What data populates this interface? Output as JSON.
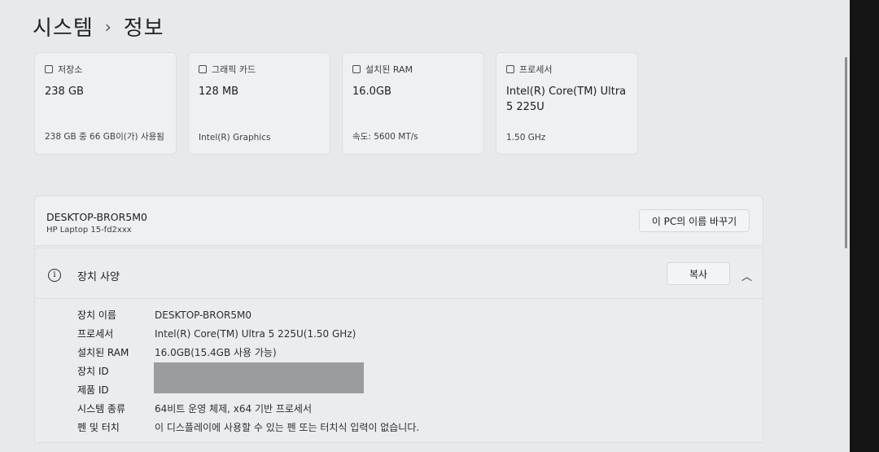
{
  "breadcrumb": {
    "parent": "시스템",
    "separator": "›",
    "current": "정보"
  },
  "cards": [
    {
      "label": "저장소",
      "value": "238 GB",
      "sub": "238 GB 중 66 GB이(가) 사용됨",
      "icon": "storage-icon"
    },
    {
      "label": "그래픽 카드",
      "value": "128 MB",
      "sub": "Intel(R) Graphics",
      "icon": "graphics-card-icon"
    },
    {
      "label": "설치된 RAM",
      "value": "16.0GB",
      "sub": "속도: 5600 MT/s",
      "icon": "ram-icon"
    },
    {
      "label": "프로세서",
      "value": "Intel(R) Core(TM) Ultra 5 225U",
      "sub": "1.50 GHz",
      "icon": "processor-icon"
    }
  ],
  "device": {
    "name": "DESKTOP-BROR5M0",
    "model": "HP Laptop 15-fd2xxx",
    "rename_label": "이 PC의 이름 바꾸기"
  },
  "specs": {
    "title": "장치 사양",
    "copy_label": "복사",
    "rows": [
      {
        "key": "장치 이름",
        "value": "DESKTOP-BROR5M0"
      },
      {
        "key": "프로세서",
        "value": "Intel(R) Core(TM) Ultra 5 225U(1.50 GHz)"
      },
      {
        "key": "설치된 RAM",
        "value": "16.0GB(15.4GB 사용 가능)"
      },
      {
        "key": "장치 ID",
        "value": ""
      },
      {
        "key": "제품 ID",
        "value": ""
      },
      {
        "key": "시스템 종류",
        "value": "64비트 운영 체제, x64 기반 프로세서"
      },
      {
        "key": "펜 및 터치",
        "value": "이 디스플레이에 사용할 수 있는 펜 또는 터치식 입력이 없습니다."
      }
    ]
  }
}
